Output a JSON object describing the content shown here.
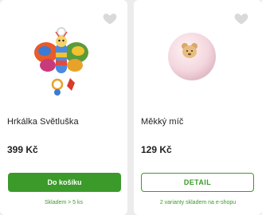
{
  "products": [
    {
      "name": "Hrkálka Světluška",
      "price": "399 Kč",
      "button_label": "Do košíku",
      "stock": "Skladem > 5 ks"
    },
    {
      "name": "Měkký míč",
      "price": "129 Kč",
      "button_label": "DETAIL",
      "stock": "2 varianty skladem na e-shopu"
    }
  ],
  "colors": {
    "accent_green": "#3b9a2a",
    "heart_gray": "#d9d9d9"
  },
  "icons": {
    "favorite": "heart-icon"
  }
}
